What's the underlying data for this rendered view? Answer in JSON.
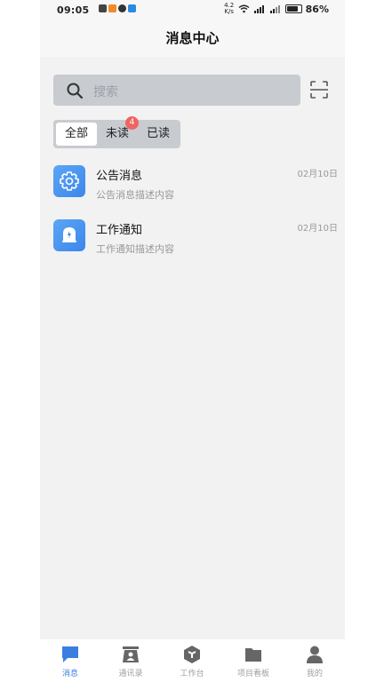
{
  "status_bar": {
    "time": "09:05",
    "net_speed_top": "4.2",
    "net_speed_bottom": "K/s",
    "battery": "86%"
  },
  "header": {
    "title": "消息中心"
  },
  "search": {
    "placeholder": "搜索"
  },
  "tabs": [
    {
      "label": "全部",
      "active": true
    },
    {
      "label": "未读",
      "badge": "4"
    },
    {
      "label": "已读"
    }
  ],
  "messages": [
    {
      "title": "公告消息",
      "desc": "公告消息描述内容",
      "date": "02月10日",
      "icon": "gear-icon"
    },
    {
      "title": "工作通知",
      "desc": "工作通知描述内容",
      "date": "02月10日",
      "icon": "bell-icon"
    }
  ],
  "bottom_nav": [
    {
      "label": "消息",
      "icon": "chat-icon",
      "active": true
    },
    {
      "label": "通讯录",
      "icon": "contacts-icon"
    },
    {
      "label": "工作台",
      "icon": "workbench-icon"
    },
    {
      "label": "项目看板",
      "icon": "folder-icon"
    },
    {
      "label": "我的",
      "icon": "person-icon"
    }
  ],
  "colors": {
    "accent": "#3a7fe0",
    "badge": "#f06464",
    "icon_gradient_start": "#5aa6f5",
    "icon_gradient_end": "#3d86ec"
  }
}
